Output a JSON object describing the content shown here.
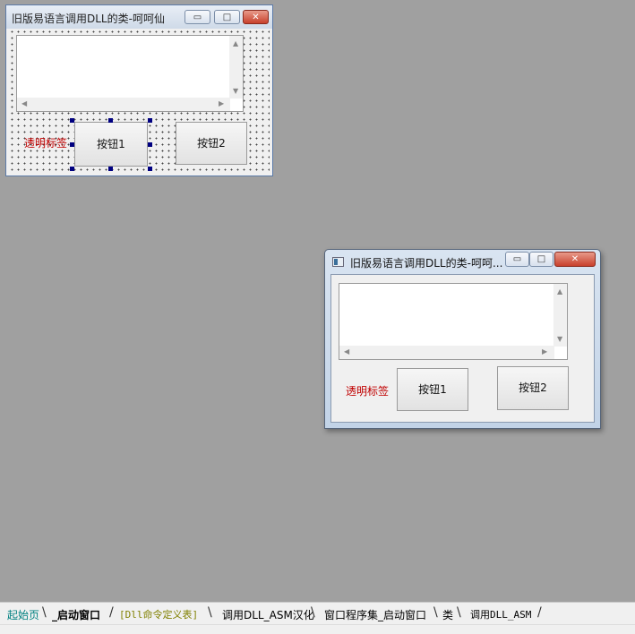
{
  "designer": {
    "title": "旧版易语言调用DLL的类-呵呵仙",
    "label": "透明标签",
    "button1": "按钮1",
    "button2": "按钮2",
    "min_glyph": "▭",
    "max_glyph": "□",
    "close_glyph": "✕"
  },
  "preview": {
    "title": "旧版易语言调用DLL的类-呵呵...",
    "label": "透明标签",
    "button1": "按钮1",
    "button2": "按钮2",
    "min_glyph": "▭",
    "max_glyph": "□",
    "close_glyph": "✕"
  },
  "tabs": [
    {
      "label": "起始页",
      "color": "#008080"
    },
    {
      "label": "_启动窗口",
      "color": "#000000"
    },
    {
      "label": "[Dll命令定义表]",
      "color": "#808000"
    },
    {
      "label": "调用DLL_ASM汉化",
      "color": "#000000"
    },
    {
      "label": "窗口程序集_启动窗口",
      "color": "#000000"
    },
    {
      "label": "类",
      "color": "#000000"
    },
    {
      "label": "调用DLL_ASM",
      "color": "#000000"
    }
  ],
  "colors": {
    "desktop": "#a0a0a0",
    "label_red": "#c00000",
    "selection_handle": "#000080"
  }
}
